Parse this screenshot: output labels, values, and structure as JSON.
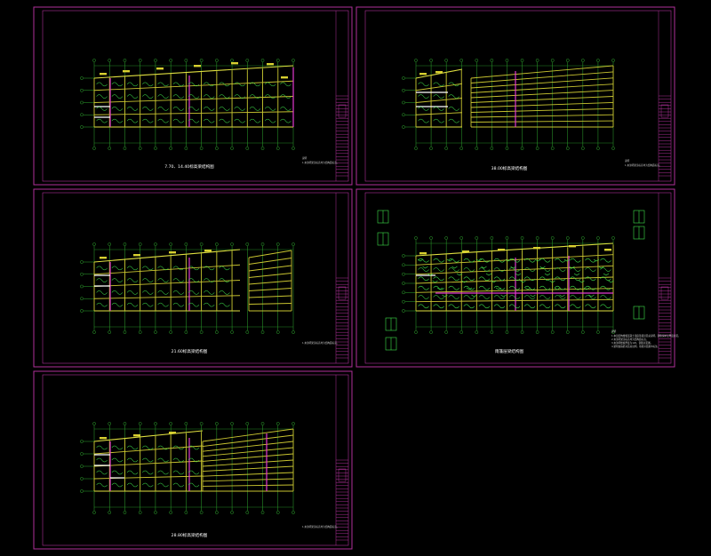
{
  "sheets": [
    {
      "id": "s1",
      "title": "7.70、14.40标高梁结构图",
      "note_head": "说明",
      "note_lines": [
        "1.未注明梁顶标高均为结构面标高。"
      ]
    },
    {
      "id": "s2",
      "title": "38.00标高梁结构图",
      "note_head": "说明",
      "note_lines": [
        "1.未注明梁顶标高均为结构面标高。"
      ]
    },
    {
      "id": "s3",
      "title": "21.60标高梁结构图",
      "note_head": "",
      "note_lines": [
        "1.未注明梁顶标高均为结构面标高。"
      ]
    },
    {
      "id": "s4",
      "title": "雨篷层梁结构图",
      "note_head": "说明",
      "note_lines": [
        "1.本层结构楼板混凝土强度等级详见总说明，钢筋保护层厚度详见。",
        "2.未注明梁顶标高均为结构面标高。",
        "3.未注明楼板厚度为120，钢筋详见图。",
        "4.梁附加箍筋详见总说明，吊筋详见图中标注。"
      ]
    },
    {
      "id": "s5",
      "title": "28.80标高梁结构图",
      "note_head": "",
      "note_lines": [
        "1.未注明梁顶标高均为结构面标高。"
      ]
    }
  ]
}
